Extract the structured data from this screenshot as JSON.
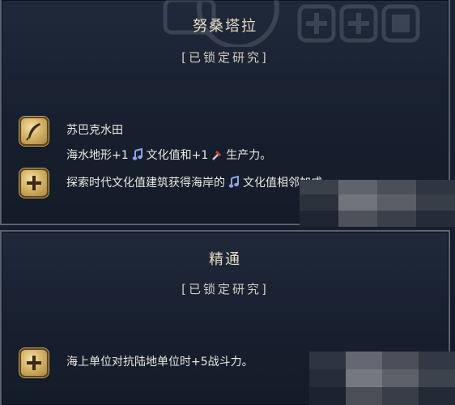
{
  "top_panel": {
    "title": "努桑塔拉",
    "status": "[已锁定研究]",
    "item1": {
      "icon": "quill-icon",
      "name": "苏巴克水田",
      "text_a": "海水地形+1",
      "text_b": "文化值和+1",
      "text_c": "生产力。"
    },
    "item2": {
      "icon": "plus-icon",
      "text_a": "探索时代文化值建筑获得海岸的",
      "text_b": "文化值相邻加成。"
    }
  },
  "bottom_panel": {
    "title": "精通",
    "status": "[已锁定研究]",
    "item1": {
      "icon": "plus-icon",
      "text": "海上单位对抗陆地单位时+5战斗力。"
    }
  },
  "colors": {
    "gold": "#d6b569",
    "culture": "#8fa0e6",
    "text": "#ece9e1",
    "border": "#5b6371"
  }
}
